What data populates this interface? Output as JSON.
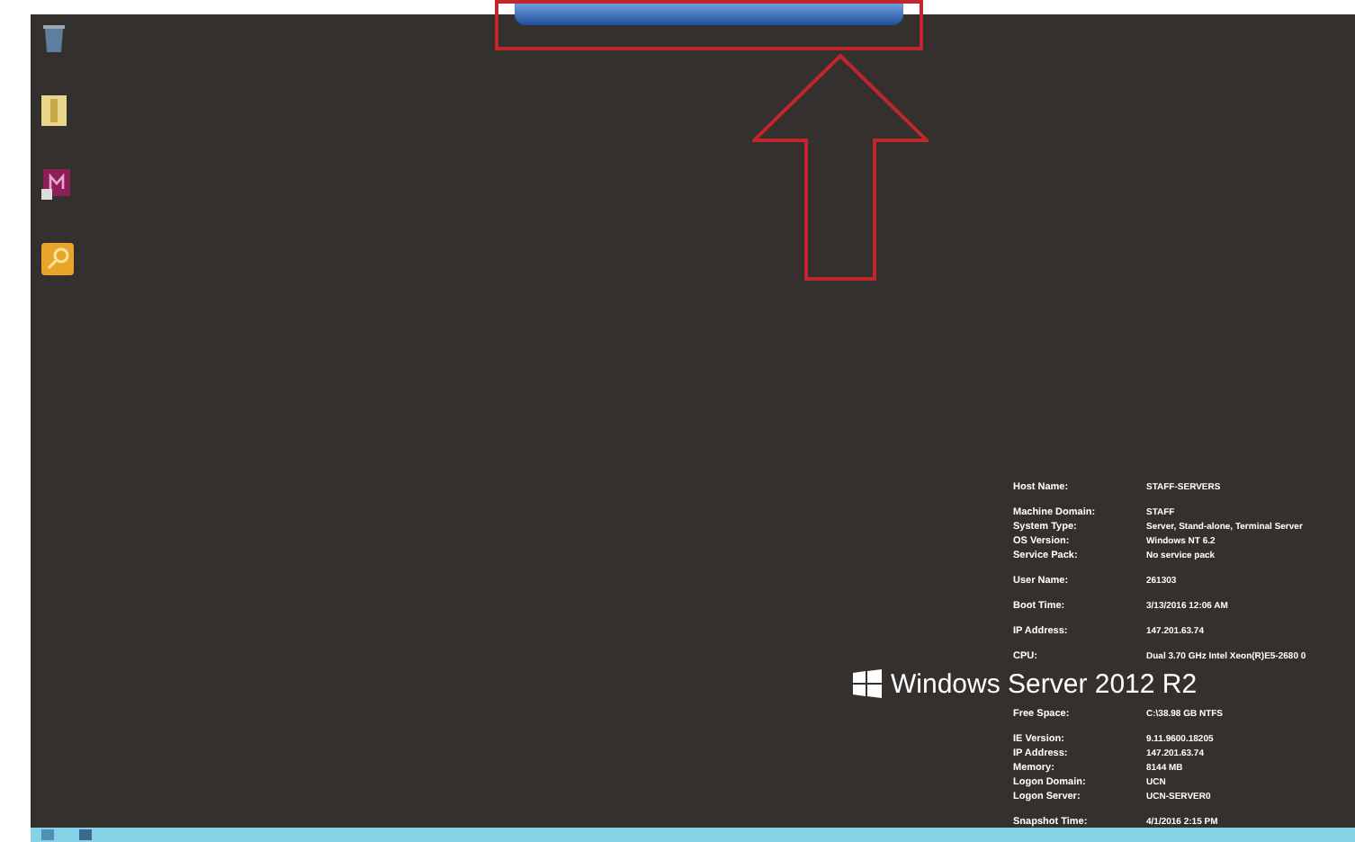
{
  "desktop": {
    "system_info": [
      [
        {
          "label": "Host Name:",
          "value": "STAFF-SERVERS"
        }
      ],
      [
        {
          "label": "Machine Domain:",
          "value": "STAFF"
        },
        {
          "label": "System Type:",
          "value": "Server, Stand-alone, Terminal Server"
        },
        {
          "label": "OS Version:",
          "value": "Windows NT 6.2"
        },
        {
          "label": "Service Pack:",
          "value": "No service pack"
        }
      ],
      [
        {
          "label": "User Name:",
          "value": "261303"
        }
      ],
      [
        {
          "label": "Boot Time:",
          "value": "3/13/2016 12:06 AM"
        }
      ],
      [
        {
          "label": "IP Address:",
          "value": "147.201.63.74"
        }
      ],
      [
        {
          "label": "CPU:",
          "value": "Dual 3.70 GHz Intel Xeon(R)E5-2680 0"
        }
      ]
    ],
    "logo": "Windows Server 2012 R2",
    "system_info_2": [
      [
        {
          "label": "Free Space:",
          "value": "C:\\38.98 GB NTFS"
        }
      ],
      [
        {
          "label": "IE Version:",
          "value": "9.11.9600.18205"
        },
        {
          "label": "IP Address:",
          "value": "147.201.63.74"
        },
        {
          "label": "Memory:",
          "value": "8144 MB"
        },
        {
          "label": "Logon Domain:",
          "value": "UCN"
        },
        {
          "label": "Logon Server:",
          "value": "UCN-SERVER0"
        }
      ],
      [
        {
          "label": "Snapshot Time:",
          "value": "4/1/2016 2:15 PM"
        }
      ]
    ]
  }
}
